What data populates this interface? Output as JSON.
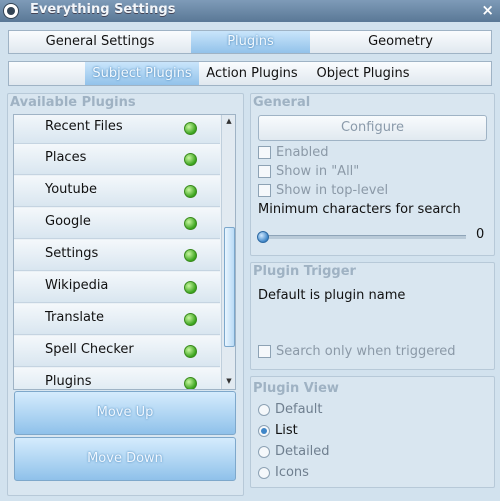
{
  "window": {
    "title": "Everything Settings",
    "close_glyph": "×"
  },
  "main_tabs": [
    {
      "label": "General Settings",
      "active": false
    },
    {
      "label": "Plugins",
      "active": true
    },
    {
      "label": "Geometry",
      "active": false
    }
  ],
  "plugin_tabs": [
    {
      "label": "Subject Plugins",
      "active": true
    },
    {
      "label": "Action Plugins",
      "active": false
    },
    {
      "label": "Object Plugins",
      "active": false
    }
  ],
  "available_plugins": {
    "title": "Available Plugins",
    "items": [
      {
        "label": "Recent Files",
        "status_color": "#3aa41e"
      },
      {
        "label": "Places",
        "status_color": "#3aa41e"
      },
      {
        "label": "Youtube",
        "status_color": "#3aa41e"
      },
      {
        "label": "Google",
        "status_color": "#3aa41e"
      },
      {
        "label": "Settings",
        "status_color": "#3aa41e"
      },
      {
        "label": "Wikipedia",
        "status_color": "#3aa41e"
      },
      {
        "label": "Translate",
        "status_color": "#3aa41e"
      },
      {
        "label": "Spell Checker",
        "status_color": "#3aa41e"
      },
      {
        "label": "Plugins",
        "status_color": "#3aa41e"
      }
    ],
    "scroll_up_glyph": "▲",
    "scroll_down_glyph": "▼",
    "move_up_label": "Move Up",
    "move_down_label": "Move Down"
  },
  "general": {
    "title": "General",
    "configure_label": "Configure",
    "enabled_label": "Enabled",
    "show_in_all_label": "Show in \"All\"",
    "show_in_top_level_label": "Show in top-level",
    "min_chars_label": "Minimum characters for search",
    "min_chars_value": "0"
  },
  "plugin_trigger": {
    "title": "Plugin Trigger",
    "description": "Default is plugin name",
    "search_only_label": "Search only when triggered"
  },
  "plugin_view": {
    "title": "Plugin View",
    "options": [
      "Default",
      "List",
      "Detailed",
      "Icons"
    ],
    "selected": "List"
  }
}
